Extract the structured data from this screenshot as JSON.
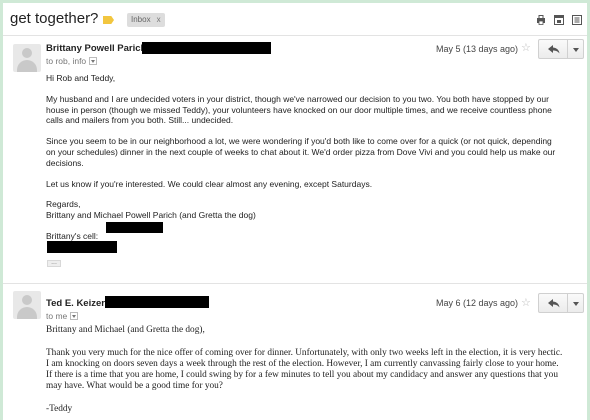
{
  "subject": "get together?",
  "labels": [
    {
      "name": "Inbox",
      "close": "x"
    }
  ],
  "toolbar_icons": [
    "print-icon",
    "new-window-icon",
    "archive-icon"
  ],
  "messages": [
    {
      "sender": "Brittany Powell Parich",
      "recipients": "to rob, info",
      "date": "May 5 (13 days ago)",
      "star": "☆",
      "paragraphs": [
        "Hi Rob and Teddy,",
        "My husband and I are undecided voters in your district, though we've narrowed our decision to you two.  You both have stopped by our house in person (though we missed Teddy), your volunteers have knocked on our door multiple times, and we receive countless phone calls and mailers from you both.  Still... undecided.",
        "Since you seem to be in our neighborhood a lot, we were wondering if you'd both like to come over for a quick (or not quick, depending on your schedules) dinner in the next couple of weeks to chat about it.  We'd order pizza from Dove Vivi and you could help us make our decisions.",
        "Let us know if you're interested.  We could clear almost any evening, except Saturdays."
      ],
      "signoff": "Regards,",
      "signature": "Brittany and Michael Powell Parich (and Gretta the dog)",
      "cell_label": "Brittany's cell:",
      "trimmed": "..."
    },
    {
      "sender": "Ted E. Keizer",
      "recipients": "to me",
      "date": "May 6 (12 days ago)",
      "star": "☆",
      "paragraphs": [
        "Brittany and Michael (and Gretta the dog),",
        "Thank you very much for the nice offer of coming over for dinner.  Unfortunately, with only two weeks left in the election, it is very hectic.  I am knocking on doors seven days a week through the rest of the election.  However, I am currently canvassing fairly close to your home.  If there is a time that you are home, I could swing by for a few minutes to tell you about my candidacy and answer any questions that you may have.  What would be a good time for you?",
        "-Teddy"
      ]
    }
  ]
}
